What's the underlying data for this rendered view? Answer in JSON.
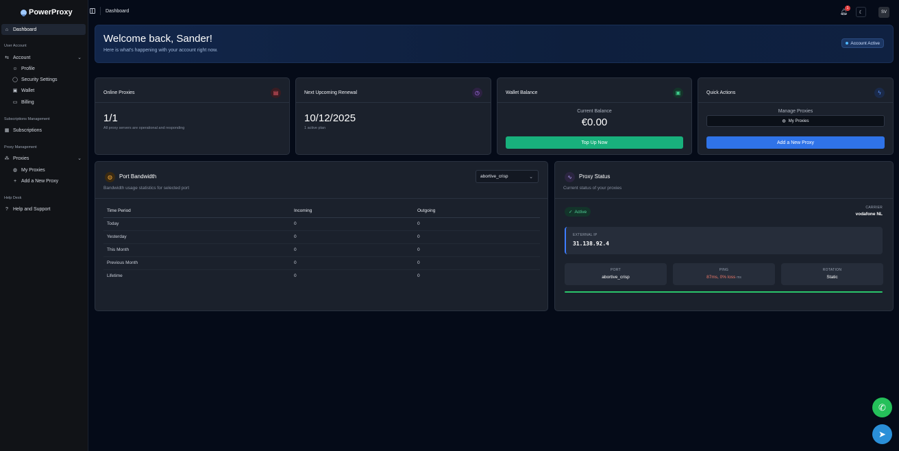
{
  "app": {
    "name": "PowerProxy"
  },
  "sidebar": {
    "dashboard": "Dashboard",
    "sections": {
      "user_account": "User Account",
      "subscriptions_management": "Subscriptions Management",
      "proxy_management": "Proxy Management",
      "help_desk": "Help Desk"
    },
    "account": "Account",
    "profile": "Profile",
    "security_settings": "Security Settings",
    "wallet": "Wallet",
    "billing": "Billing",
    "subscriptions": "Subscriptions",
    "proxies": "Proxies",
    "my_proxies": "My Proxies",
    "add_new_proxy": "Add a New Proxy",
    "help_and_support": "Help and Support"
  },
  "topbar": {
    "breadcrumb": "Dashboard",
    "notification_count": "1",
    "avatar_initials": "SV"
  },
  "welcome": {
    "title": "Welcome back, Sander!",
    "subtitle": "Here is what's happening with your account right now.",
    "status": "Account Active"
  },
  "cards": {
    "online_proxies": {
      "title": "Online Proxies",
      "value": "1/1",
      "note": "All proxy servers are operational and responding"
    },
    "renewal": {
      "title": "Next Upcoming Renewal",
      "value": "10/12/2025",
      "note": "1 active plan"
    },
    "wallet": {
      "title": "Wallet Balance",
      "label": "Current Balance",
      "value": "€0.00",
      "button": "Top Up Now"
    },
    "quick_actions": {
      "title": "Quick Actions",
      "label": "Manage Proxies",
      "my_proxies": "My Proxies",
      "add_proxy": "Add a New Proxy"
    }
  },
  "bandwidth": {
    "title": "Port Bandwidth",
    "subtitle": "Bandwidth usage statistics for selected port",
    "selected_port": "abortive_crisp",
    "columns": [
      "Time Period",
      "Incoming",
      "Outgoing"
    ],
    "rows": [
      [
        "Today",
        "0",
        "0"
      ],
      [
        "Yesterday",
        "0",
        "0"
      ],
      [
        "This Month",
        "0",
        "0"
      ],
      [
        "Previous Month",
        "0",
        "0"
      ],
      [
        "Lifetime",
        "0",
        "0"
      ]
    ]
  },
  "proxy_status": {
    "title": "Proxy Status",
    "subtitle": "Current status of your proxies",
    "status": "Active",
    "carrier_label": "CARRIER",
    "carrier": "vodafone NL",
    "ip_label": "EXTERNAL IP",
    "ip": "31.138.92.4",
    "port_label": "PORT",
    "port": "abortive_crisp",
    "ping_label": "PING",
    "ping": "87ms, 0% loss",
    "ping_unit": "ms",
    "rotation_label": "ROTATION",
    "rotation": "Static"
  },
  "colors": {
    "accent_blue": "#2f73e8",
    "accent_green": "#18b07c",
    "status_green": "#2bc76b"
  }
}
